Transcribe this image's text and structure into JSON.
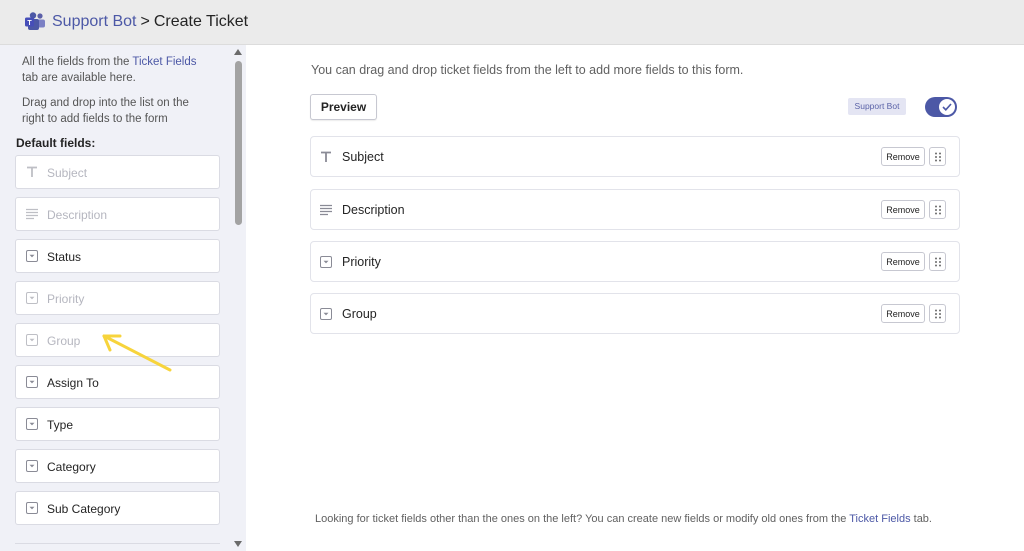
{
  "header": {
    "app_name": "Support Bot",
    "separator": ">",
    "page_title": "Create Ticket"
  },
  "sidebar": {
    "intro_1_prefix": "All the fields from the ",
    "intro_1_link": "Ticket Fields",
    "intro_1_suffix": " tab are available here.",
    "intro_2": "Drag and drop into the list on the right to add fields to the form",
    "default_label": "Default fields:",
    "fields": [
      {
        "label": "Subject",
        "icon": "text-icon",
        "disabled": true
      },
      {
        "label": "Description",
        "icon": "paragraph-icon",
        "disabled": true
      },
      {
        "label": "Status",
        "icon": "dropdown-icon",
        "disabled": false
      },
      {
        "label": "Priority",
        "icon": "dropdown-icon",
        "disabled": true
      },
      {
        "label": "Group",
        "icon": "dropdown-icon",
        "disabled": true
      },
      {
        "label": "Assign To",
        "icon": "dropdown-icon",
        "disabled": false
      },
      {
        "label": "Type",
        "icon": "dropdown-icon",
        "disabled": false
      },
      {
        "label": "Category",
        "icon": "dropdown-icon",
        "disabled": false
      },
      {
        "label": "Sub Category",
        "icon": "dropdown-icon",
        "disabled": false
      }
    ]
  },
  "main": {
    "hint": "You can drag and drop ticket fields from the left to add more fields to this form.",
    "preview_label": "Preview",
    "badge": "Support Bot",
    "toggle_on": true,
    "rows": [
      {
        "label": "Subject",
        "icon": "text-icon",
        "remove_label": "Remove"
      },
      {
        "label": "Description",
        "icon": "paragraph-icon",
        "remove_label": "Remove"
      },
      {
        "label": "Priority",
        "icon": "dropdown-icon",
        "remove_label": "Remove"
      },
      {
        "label": "Group",
        "icon": "dropdown-icon",
        "remove_label": "Remove"
      }
    ],
    "footer_prefix": "Looking for ticket fields other than the ones on the left? You can create new fields or modify old ones from the ",
    "footer_link": "Ticket Fields",
    "footer_suffix": " tab."
  },
  "colors": {
    "accent": "#4c58a6",
    "annotation_arrow": "#f7d43c"
  }
}
